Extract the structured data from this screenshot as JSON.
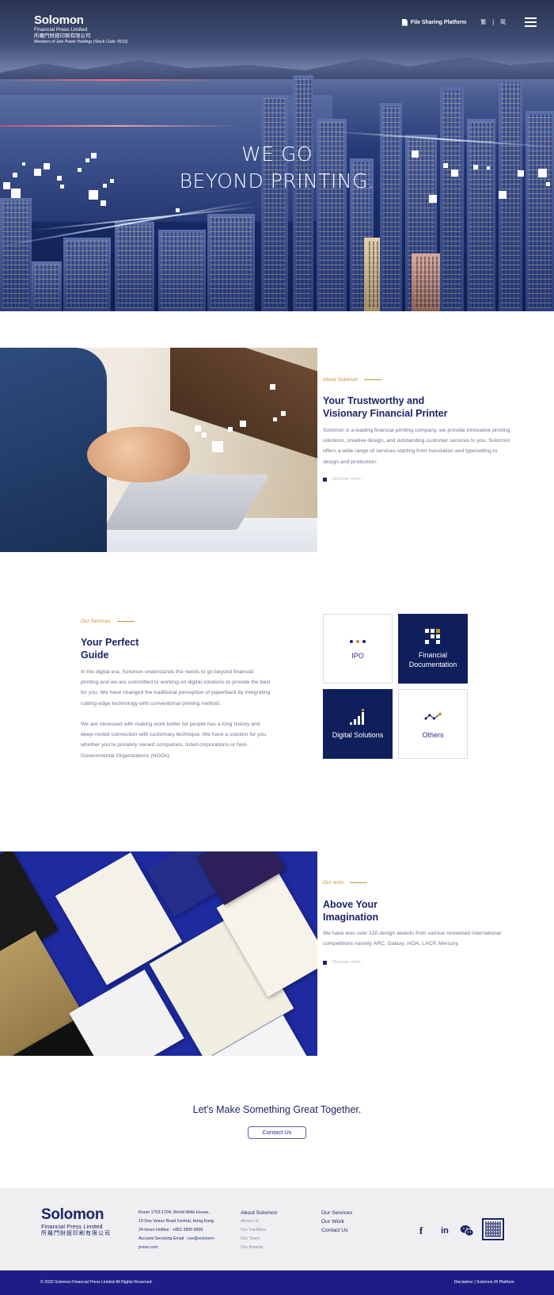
{
  "header": {
    "logo_name": "Solomon",
    "logo_sub": "Financial Press Limited",
    "logo_chinese": "所羅門財經印刷有限公司",
    "logo_member": "Members of Jete Power Holdings (Stock Code: 8153)",
    "file_sharing": "File Sharing Platform",
    "lang_trad": "繁",
    "lang_sep": "|",
    "lang_simp": "简",
    "menu_icon": "hamburger-icon"
  },
  "hero": {
    "line1": "WE GO",
    "line2": "BEYOND PRINTING."
  },
  "about": {
    "label": "About Solomon",
    "title_line1": "Your Trustworthy and",
    "title_line2": "Visionary Financial Printer",
    "text": "Solomon is a leading financial printing company, we provide innovative printing solutions, creative design, and outstanding customer services to you. Solomon offers a wide range of services starting from translation and typesetting to design and production.",
    "more": "Discover more..."
  },
  "services": {
    "label": "Our Services",
    "title_line1": "Your Perfect",
    "title_line2": "Guide",
    "para1": "In the digital era, Solomon understands the needs to go beyond financial printing and we are committed to working on digital solutions to provide the best for you. We have changed the traditional perception of paperback by integrating cutting-edge technology with conventional printing method.",
    "para2": "We are obsessed with making work better for people has a long history and deep-rooted connection with customary technique. We have a solution for you whether you're privately owned companies, listed corporations or Non-Governmental Organizations (NGOs).",
    "tiles": [
      {
        "label": "IPO",
        "icon": "dots-icon"
      },
      {
        "label_line1": "Financial",
        "label_line2": "Documentation",
        "icon": "document-grid-icon"
      },
      {
        "label": "Digital Solutions",
        "icon": "bar-chart-icon"
      },
      {
        "label": "Others",
        "icon": "network-icon"
      }
    ]
  },
  "work": {
    "label": "Our work",
    "title_line1": "Above Your",
    "title_line2": "Imagination",
    "text": "We have won over 120 design awards from various renowned international competitions namely ARC, Galaxy, iADA, LACP, Mercury.",
    "more": "Discover more..."
  },
  "cta": {
    "title": "Let's Make Something Great Together.",
    "button": "Contact Us"
  },
  "footer": {
    "logo_name": "Solomon",
    "logo_sub": "Financial Press Limited",
    "logo_chinese": "所羅門財經印刷有限公司",
    "address_line1": "Room 1703-1704, World-Wide House,",
    "address_line2": "19 Des Voeux Road Central, Hong Kong",
    "hotline": "24 hours Hotline : +852 3900 9600",
    "email_label": "Account Servicing Email : ",
    "email_value": "cse@solomon-press.com",
    "about_head": "About Solomon",
    "about_items": [
      "About Us",
      "Our Facilities",
      "Our Team",
      "Our Awards"
    ],
    "links": [
      "Our Services",
      "Our Work",
      "Contact Us"
    ],
    "social": [
      "facebook-icon",
      "linkedin-icon",
      "wechat-icon"
    ],
    "qr_icon": "qr-code-icon",
    "copyright": "© 2020 Solomon Financial Press Limited All Rights Reserved.",
    "disclaimer": "Disclaimer",
    "sep": "|",
    "ir_platform": "Solomon IR Platform"
  },
  "colors": {
    "navy": "#1c2466",
    "accent": "#c8922c",
    "tile_dark": "#0f1f5b",
    "bottom_bar": "#1e1c86"
  }
}
